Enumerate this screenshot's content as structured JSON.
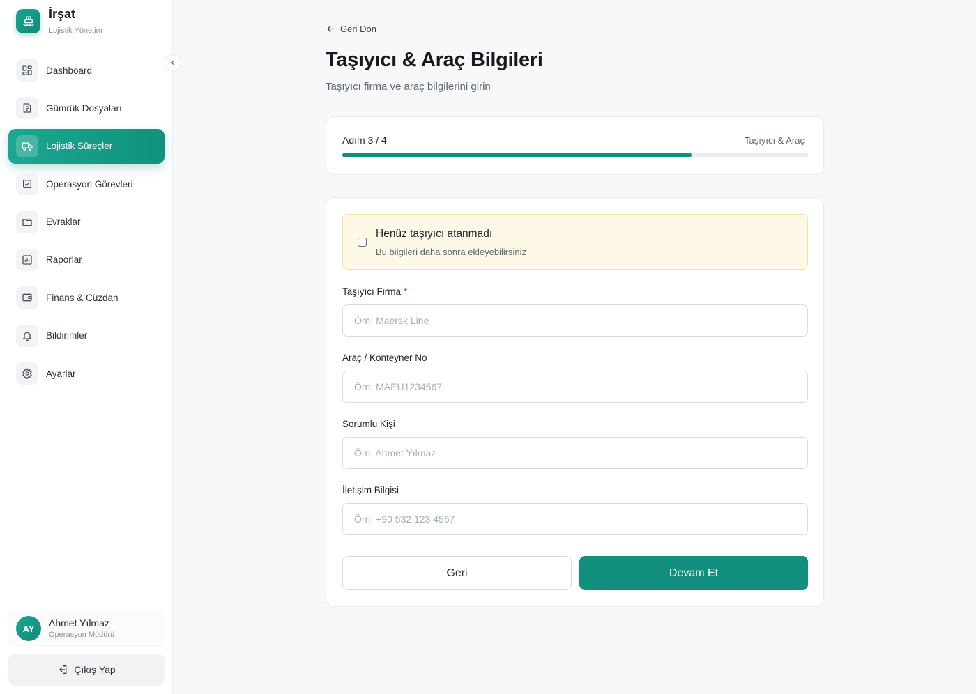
{
  "brand": {
    "name": "İrşat",
    "subtitle": "Lojistik Yönetim"
  },
  "sidebar": {
    "items": [
      {
        "label": "Dashboard",
        "icon": "grid-icon",
        "active": false
      },
      {
        "label": "Gümrük Dosyaları",
        "icon": "document-icon",
        "active": false
      },
      {
        "label": "Lojistik Süreçler",
        "icon": "truck-icon",
        "active": true
      },
      {
        "label": "Operasyon Görevleri",
        "icon": "checkbox-icon",
        "active": false
      },
      {
        "label": "Evraklar",
        "icon": "folder-icon",
        "active": false
      },
      {
        "label": "Raporlar",
        "icon": "bar-chart-icon",
        "active": false
      },
      {
        "label": "Finans & Cüzdan",
        "icon": "wallet-icon",
        "active": false
      },
      {
        "label": "Bildirimler",
        "icon": "bell-icon",
        "active": false
      },
      {
        "label": "Ayarlar",
        "icon": "gear-icon",
        "active": false
      }
    ]
  },
  "user": {
    "initials": "AY",
    "name": "Ahmet Yılmaz",
    "role": "Operasyon Müdürü"
  },
  "logout_label": "Çıkış Yap",
  "main": {
    "back_label": "Geri Dön",
    "title": "Taşıyıcı & Araç Bilgileri",
    "subtitle": "Taşıyıcı firma ve araç bilgilerini girin"
  },
  "progress": {
    "step_label": "Adım 3 / 4",
    "step_name": "Taşıyıcı & Araç",
    "fraction": 0.75
  },
  "notice": {
    "title": "Henüz taşıyıcı atanmadı",
    "subtitle": "Bu bilgileri daha sonra ekleyebilirsiniz"
  },
  "form": {
    "carrier": {
      "label": "Taşıyıcı Firma",
      "required_mark": "*",
      "placeholder": "Örn: Maersk Line"
    },
    "vehicle": {
      "label": "Araç / Konteyner No",
      "placeholder": "Örn: MAEU1234567"
    },
    "person": {
      "label": "Sorumlu Kişi",
      "placeholder": "Örn: Ahmet Yılmaz"
    },
    "contact": {
      "label": "İletişim Bilgisi",
      "placeholder": "Örn: +90 532 123 4567"
    },
    "back_button": "Geri",
    "next_button": "Devam Et"
  },
  "colors": {
    "accent": "#13907d",
    "notice_bg": "#fdf9e6",
    "notice_border": "#f3e3a2"
  }
}
